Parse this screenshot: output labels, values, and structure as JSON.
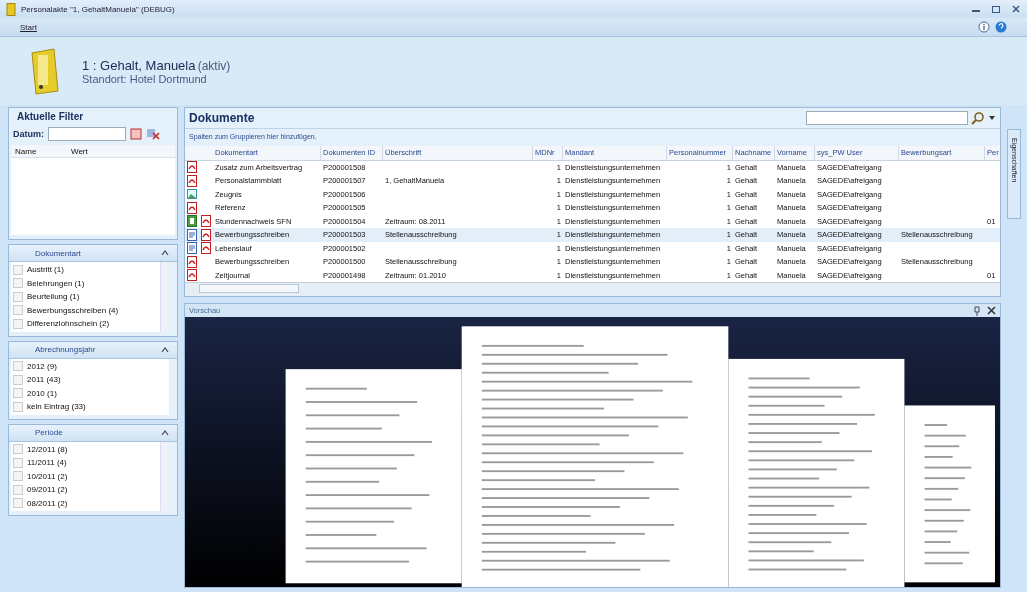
{
  "window": {
    "title": "Personalakte \"1, GehaltManuela\" (DEBUG)"
  },
  "menu": [
    {
      "label": "Start",
      "selected": true
    }
  ],
  "header": {
    "name": "1 : Gehalt, Manuela",
    "status": "(aktiv)",
    "location": "Standort: Hotel Dortmund"
  },
  "filter": {
    "title": "Aktuelle Filter",
    "date_label": "Datum:",
    "columns": [
      "Name",
      "Wert"
    ]
  },
  "groups": [
    {
      "title": "Dokumentart",
      "expanded": true,
      "scroll": true,
      "items": [
        {
          "label": "Austritt (1)",
          "checked": false
        },
        {
          "label": "Belehrungen (1)",
          "checked": false
        },
        {
          "label": "Beurteilung (1)",
          "checked": false
        },
        {
          "label": "Bewerbungsschreiben (4)",
          "checked": false
        },
        {
          "label": "Differenzlohnschein (2)",
          "checked": false
        }
      ]
    },
    {
      "title": "Abrechnungsjahr",
      "expanded": true,
      "scroll": false,
      "items": [
        {
          "label": "2012 (9)",
          "checked": false
        },
        {
          "label": "2011 (43)",
          "checked": false
        },
        {
          "label": "2010 (1)",
          "checked": false
        },
        {
          "label": "kein Eintrag (33)",
          "checked": false
        }
      ]
    },
    {
      "title": "Periode",
      "expanded": true,
      "scroll": true,
      "items": [
        {
          "label": "12/2011 (8)",
          "checked": false
        },
        {
          "label": "11/2011 (4)",
          "checked": false
        },
        {
          "label": "10/2011 (2)",
          "checked": false
        },
        {
          "label": "09/2011 (2)",
          "checked": false
        },
        {
          "label": "08/2011 (2)",
          "checked": false
        }
      ]
    }
  ],
  "documents": {
    "title": "Dokumente",
    "group_hint": "Spalten zum Gruppieren hier hinzufügen.",
    "columns": [
      "Dokumentart",
      "Dokumenten ID",
      "Überschrift",
      "MDNr",
      "Mandant",
      "Personalnummer",
      "Nachname",
      "Vorname",
      "sys_PW User",
      "Bewerbungsart",
      "Per"
    ],
    "rows": [
      {
        "icons": [
          {
            "kind": "pdf"
          }
        ],
        "selected": false,
        "cells": [
          "Zusatz zum Arbeitsvertrag",
          "P200001508",
          "",
          "1",
          "Dienstleistungsunternehmen",
          "1",
          "Gehalt",
          "Manuela",
          "SAGEDE\\afreigang",
          "",
          ""
        ]
      },
      {
        "icons": [
          {
            "kind": "pdf"
          }
        ],
        "selected": false,
        "cells": [
          "Personalstammblatt",
          "P200001507",
          "1, GehaltManuela",
          "1",
          "Dienstleistungsunternehmen",
          "1",
          "Gehalt",
          "Manuela",
          "SAGEDE\\afreigang",
          "",
          ""
        ]
      },
      {
        "icons": [
          {
            "kind": "image"
          }
        ],
        "selected": false,
        "cells": [
          "Zeugnis",
          "P200001506",
          "",
          "1",
          "Dienstleistungsunternehmen",
          "1",
          "Gehalt",
          "Manuela",
          "SAGEDE\\afreigang",
          "",
          ""
        ]
      },
      {
        "icons": [
          {
            "kind": "pdf"
          }
        ],
        "selected": false,
        "cells": [
          "Referenz",
          "P200001505",
          "",
          "1",
          "Dienstleistungsunternehmen",
          "1",
          "Gehalt",
          "Manuela",
          "SAGEDE\\afreigang",
          "",
          ""
        ]
      },
      {
        "icons": [
          {
            "kind": "sheet"
          },
          {
            "kind": "pdf"
          }
        ],
        "selected": false,
        "cells": [
          "Stundennachweis SFN",
          "P200001504",
          "Zeitraum: 08.2011",
          "1",
          "Dienstleistungsunternehmen",
          "1",
          "Gehalt",
          "Manuela",
          "SAGEDE\\afreigang",
          "",
          "01"
        ]
      },
      {
        "icons": [
          {
            "kind": "doc"
          },
          {
            "kind": "pdf"
          }
        ],
        "selected": true,
        "cells": [
          "Bewerbungsschreiben",
          "P200001503",
          "Stellenausschreibung",
          "1",
          "Dienstleistungsunternehmen",
          "1",
          "Gehalt",
          "Manuela",
          "SAGEDE\\afreigang",
          "Stellenausschreibung",
          ""
        ]
      },
      {
        "icons": [
          {
            "kind": "doc"
          },
          {
            "kind": "pdf"
          }
        ],
        "selected": false,
        "cells": [
          "Lebenslauf",
          "P200001502",
          "",
          "1",
          "Dienstleistungsunternehmen",
          "1",
          "Gehalt",
          "Manuela",
          "SAGEDE\\afreigang",
          "",
          ""
        ]
      },
      {
        "icons": [
          {
            "kind": "pdf"
          }
        ],
        "selected": false,
        "cells": [
          "Bewerbungsschreiben",
          "P200001500",
          "Stellenausschreibung",
          "1",
          "Dienstleistungsunternehmen",
          "1",
          "Gehalt",
          "Manuela",
          "SAGEDE\\afreigang",
          "Stellenausschreibung",
          ""
        ]
      },
      {
        "icons": [
          {
            "kind": "pdf"
          }
        ],
        "selected": false,
        "cells": [
          "Zeitjournal",
          "P200001498",
          "Zeitraum: 01.2010",
          "1",
          "Dienstleistungsunternehmen",
          "1",
          "Gehalt",
          "Manuela",
          "SAGEDE\\afreigang",
          "",
          "01"
        ]
      }
    ]
  },
  "preview": {
    "title": "Vorschau"
  },
  "side_tab": {
    "label": "Eigenschaften"
  }
}
